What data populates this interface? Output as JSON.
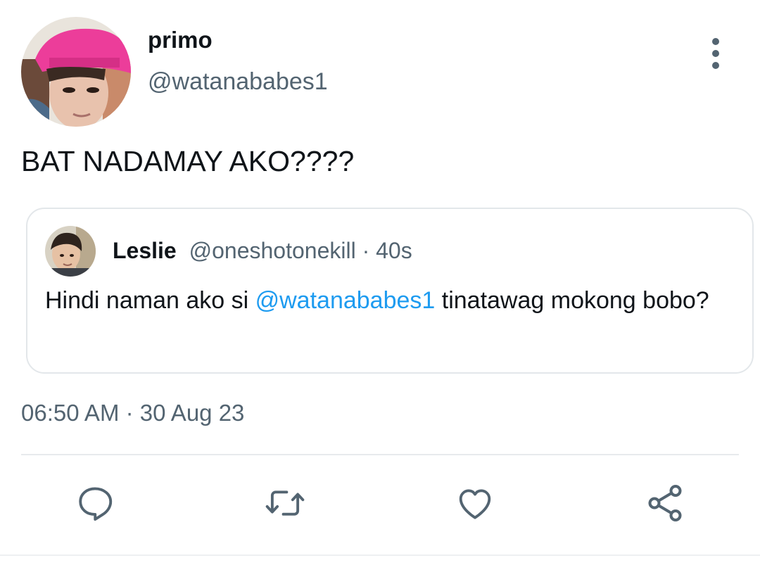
{
  "tweet": {
    "author": {
      "display_name": "primo",
      "handle": "@watanababes1",
      "avatar": "avatar-pink-cap"
    },
    "more_icon": "more-vertical-icon",
    "text": "BAT NADAMAY AKO????",
    "quoted": {
      "display_name": "Leslie",
      "handle": "@oneshotonekill",
      "separator": " · ",
      "age": "40s",
      "avatar": "avatar-leslie",
      "text_before": "Hindi naman ako si ",
      "mention": "@watanababes1",
      "text_after": " tinatawag mokong bobo?"
    },
    "timestamp": "06:50 AM · 30 Aug 23"
  },
  "actions": [
    {
      "name": "reply",
      "icon": "reply-icon"
    },
    {
      "name": "retweet",
      "icon": "retweet-icon"
    },
    {
      "name": "like",
      "icon": "heart-icon"
    },
    {
      "name": "share",
      "icon": "share-icon"
    }
  ],
  "colors": {
    "text": "#0f1419",
    "secondary": "#536471",
    "link": "#1d9bf0",
    "border": "#e3e7ea",
    "icon": "#536471"
  }
}
